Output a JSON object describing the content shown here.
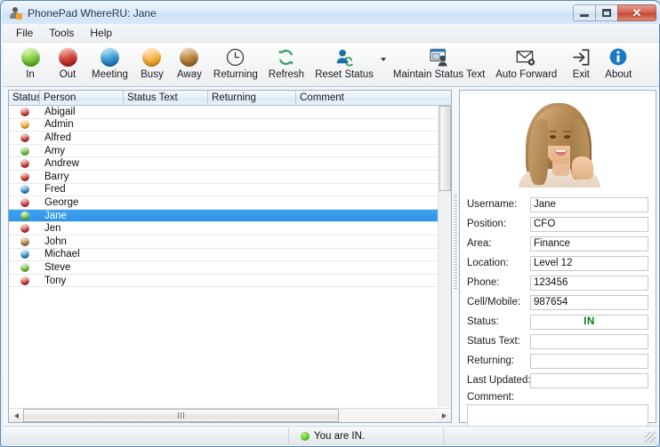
{
  "window": {
    "title": "PhonePad WhereRU: Jane",
    "app_icon": "person-icon",
    "minimize_label": "",
    "maximize_label": "",
    "close_label": "✕"
  },
  "menubar": {
    "items": [
      {
        "label": "File"
      },
      {
        "label": "Tools"
      },
      {
        "label": "Help"
      }
    ]
  },
  "toolbar": {
    "items": [
      {
        "label": "In",
        "icon": "green-dot-icon",
        "color": "#6abd2b"
      },
      {
        "label": "Out",
        "icon": "red-dot-icon",
        "color": "#c42a25"
      },
      {
        "label": "Meeting",
        "icon": "blue-dot-icon",
        "color": "#1f87c5"
      },
      {
        "label": "Busy",
        "icon": "orange-dot-icon",
        "color": "#f0a629"
      },
      {
        "label": "Away",
        "icon": "brown-dot-icon",
        "color": "#a8722b"
      },
      {
        "label": "Returning",
        "icon": "clock-icon",
        "color": "#3b3b3b"
      },
      {
        "label": "Refresh",
        "icon": "refresh-arrows-icon",
        "color": "#2f9e5c"
      },
      {
        "label": "Reset Status",
        "icon": "reset-status-person-icon",
        "color": "#1c6ea4"
      },
      {
        "label": "Maintain Status Text",
        "icon": "maintain-status-text-icon",
        "color": "#1c6ea4"
      },
      {
        "label": "Auto Forward",
        "icon": "envelope-gear-icon",
        "color": "#3b3b3b"
      },
      {
        "label": "Exit",
        "icon": "exit-arrow-icon",
        "color": "#3b3b3b"
      },
      {
        "label": "About",
        "icon": "info-circle-icon",
        "color": "#1c78c0"
      }
    ],
    "reset_status_dropdown": "chevron-down-icon"
  },
  "list": {
    "columns": [
      {
        "label": "Status"
      },
      {
        "label": "Person"
      },
      {
        "label": "Status Text"
      },
      {
        "label": "Returning"
      },
      {
        "label": "Comment"
      }
    ],
    "rows": [
      {
        "person": "Abigail",
        "status_color": "#c42a25",
        "status_text": "",
        "returning": "",
        "comment": "",
        "selected": false
      },
      {
        "person": "Admin",
        "status_color": "#f0a629",
        "status_text": "",
        "returning": "",
        "comment": "",
        "selected": false
      },
      {
        "person": "Alfred",
        "status_color": "#c42a25",
        "status_text": "",
        "returning": "",
        "comment": "",
        "selected": false
      },
      {
        "person": "Amy",
        "status_color": "#62bd2b",
        "status_text": "",
        "returning": "",
        "comment": "",
        "selected": false
      },
      {
        "person": "Andrew",
        "status_color": "#c42a25",
        "status_text": "",
        "returning": "",
        "comment": "",
        "selected": false
      },
      {
        "person": "Barry",
        "status_color": "#c42a25",
        "status_text": "",
        "returning": "",
        "comment": "",
        "selected": false
      },
      {
        "person": "Fred",
        "status_color": "#1f87c5",
        "status_text": "",
        "returning": "",
        "comment": "",
        "selected": false
      },
      {
        "person": "George",
        "status_color": "#c42a25",
        "status_text": "",
        "returning": "",
        "comment": "",
        "selected": false
      },
      {
        "person": "Jane",
        "status_color": "#62bd2b",
        "status_text": "",
        "returning": "",
        "comment": "",
        "selected": true
      },
      {
        "person": "Jen",
        "status_color": "#c42a25",
        "status_text": "",
        "returning": "",
        "comment": "",
        "selected": false
      },
      {
        "person": "John",
        "status_color": "#a8722b",
        "status_text": "",
        "returning": "",
        "comment": "",
        "selected": false
      },
      {
        "person": "Michael",
        "status_color": "#1f87c5",
        "status_text": "",
        "returning": "",
        "comment": "",
        "selected": false
      },
      {
        "person": "Steve",
        "status_color": "#62bd2b",
        "status_text": "",
        "returning": "",
        "comment": "",
        "selected": false
      },
      {
        "person": "Tony",
        "status_color": "#c42a25",
        "status_text": "",
        "returning": "",
        "comment": "",
        "selected": false
      }
    ]
  },
  "detail": {
    "photo_alt": "portrait-photo",
    "fields": [
      {
        "label": "Username:",
        "value": "Jane"
      },
      {
        "label": "Position:",
        "value": "CFO"
      },
      {
        "label": "Area:",
        "value": "Finance"
      },
      {
        "label": "Location:",
        "value": "Level 12"
      },
      {
        "label": "Phone:",
        "value": "123456"
      },
      {
        "label": "Cell/Mobile:",
        "value": "987654"
      },
      {
        "label": "Status:",
        "value": "IN"
      },
      {
        "label": "Status Text:",
        "value": ""
      },
      {
        "label": "Returning:",
        "value": ""
      },
      {
        "label": "Last Updated:",
        "value": ""
      }
    ],
    "status_color": "#0a7a18",
    "comment_label": "Comment:",
    "comment_value": ""
  },
  "statusbar": {
    "left_text": "",
    "status_dot": "green-dot-icon",
    "status_message": "You are IN."
  }
}
